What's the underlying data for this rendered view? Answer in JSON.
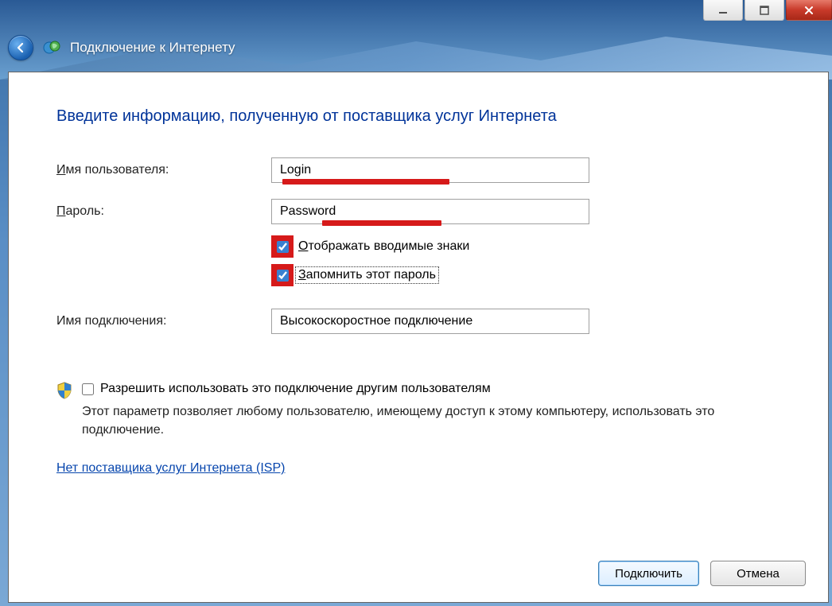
{
  "window": {
    "title": "Подключение к Интернету"
  },
  "page": {
    "heading": "Введите информацию, полученную от поставщика услуг Интернета"
  },
  "fields": {
    "username_label_pre": "И",
    "username_label_post": "мя пользователя:",
    "username_value": "Login",
    "password_label_pre": "П",
    "password_label_post": "ароль:",
    "password_value": "Password",
    "connection_name_label": "Имя подключения:",
    "connection_name_value": "Высокоскоростное подключение"
  },
  "checkboxes": {
    "show_chars_pre": "О",
    "show_chars_post": "тображать вводимые знаки",
    "show_chars_checked": true,
    "remember_pre": "З",
    "remember_post": "апомнить этот пароль",
    "remember_checked": true,
    "allow_others_pre": "Р",
    "allow_others_post": "азрешить использовать это подключение другим пользователям",
    "allow_others_checked": false,
    "allow_others_desc": "Этот параметр позволяет любому пользователю, имеющему доступ к этому компьютеру, использовать это подключение."
  },
  "links": {
    "no_isp": "Нет поставщика услуг Интернета (ISP)"
  },
  "buttons": {
    "connect": "Подключить",
    "cancel": "Отмена"
  }
}
